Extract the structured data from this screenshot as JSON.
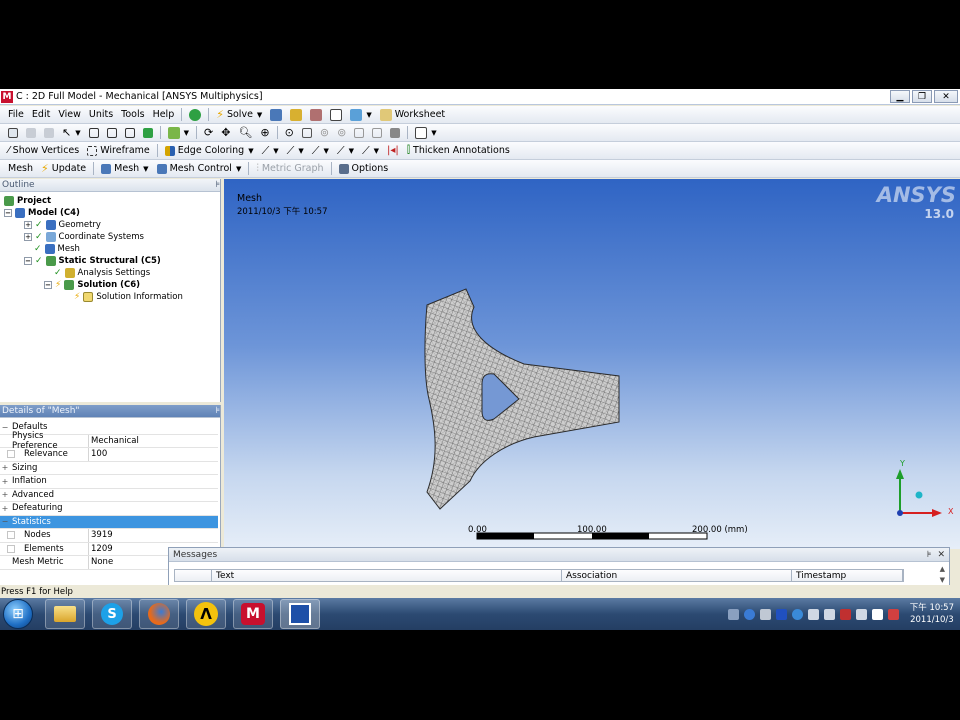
{
  "window": {
    "title": "C : 2D Full Model - Mechanical [ANSYS Multiphysics]",
    "app_icon": "M"
  },
  "menu": [
    "File",
    "Edit",
    "View",
    "Units",
    "Tools",
    "Help"
  ],
  "toolbar1": {
    "solve_label": "Solve",
    "worksheet_label": "Worksheet"
  },
  "toolbar3": {
    "show_vertices": "Show Vertices",
    "wireframe": "Wireframe",
    "edge_coloring": "Edge Coloring",
    "thicken_annotations": "Thicken Annotations"
  },
  "toolbar4": {
    "mesh": "Mesh",
    "update": "Update",
    "mesh_menu": "Mesh",
    "mesh_control": "Mesh Control",
    "metric_graph": "Metric Graph",
    "options": "Options"
  },
  "outline": {
    "title": "Outline",
    "tree": [
      {
        "label": "Project",
        "bold": true
      },
      {
        "label": "Model (C4)",
        "bold": true
      },
      {
        "label": "Geometry",
        "bold": false
      },
      {
        "label": "Coordinate Systems",
        "bold": false
      },
      {
        "label": "Mesh",
        "bold": false
      },
      {
        "label": "Static Structural (C5)",
        "bold": true
      },
      {
        "label": "Analysis Settings",
        "bold": false
      },
      {
        "label": "Solution (C6)",
        "bold": true
      },
      {
        "label": "Solution Information",
        "bold": false
      }
    ]
  },
  "details": {
    "title": "Details of \"Mesh\"",
    "rows": [
      {
        "name": "Defaults",
        "value": "",
        "type": "group",
        "exp": "−"
      },
      {
        "name": "Physics Preference",
        "value": "Mechanical",
        "type": "prop"
      },
      {
        "name": "Relevance",
        "value": "100",
        "type": "sub"
      },
      {
        "name": "Sizing",
        "value": "",
        "type": "group",
        "exp": "+"
      },
      {
        "name": "Inflation",
        "value": "",
        "type": "group",
        "exp": "+"
      },
      {
        "name": "Advanced",
        "value": "",
        "type": "group",
        "exp": "+"
      },
      {
        "name": "Defeaturing",
        "value": "",
        "type": "group",
        "exp": "+"
      },
      {
        "name": "Statistics",
        "value": "",
        "type": "group-sel",
        "exp": "−"
      },
      {
        "name": "Nodes",
        "value": "3919",
        "type": "sub"
      },
      {
        "name": "Elements",
        "value": "1209",
        "type": "sub"
      },
      {
        "name": "Mesh Metric",
        "value": "None",
        "type": "prop"
      }
    ]
  },
  "viewport": {
    "label": "Mesh",
    "date": "2011/10/3 下午 10:57",
    "logo": "ANSYS",
    "version": "13.0",
    "scale": [
      "0.00",
      "100.00",
      "200.00 (mm)"
    ],
    "axis_y": "Y",
    "axis_x": "X"
  },
  "messages": {
    "title": "Messages",
    "columns": [
      "Text",
      "Association",
      "Timestamp"
    ]
  },
  "status": "Press F1 for Help",
  "taskbar": {
    "clock_time": "下午 10:57",
    "clock_date": "2011/10/3"
  },
  "colors": {
    "viewport_top": "#2f64c4",
    "mesh_fill": "#cfcfcf",
    "selection": "#3d95e0",
    "axis_x": "#d62020",
    "axis_y": "#1e9e2a",
    "axis_origin": "#1fb5c8"
  }
}
